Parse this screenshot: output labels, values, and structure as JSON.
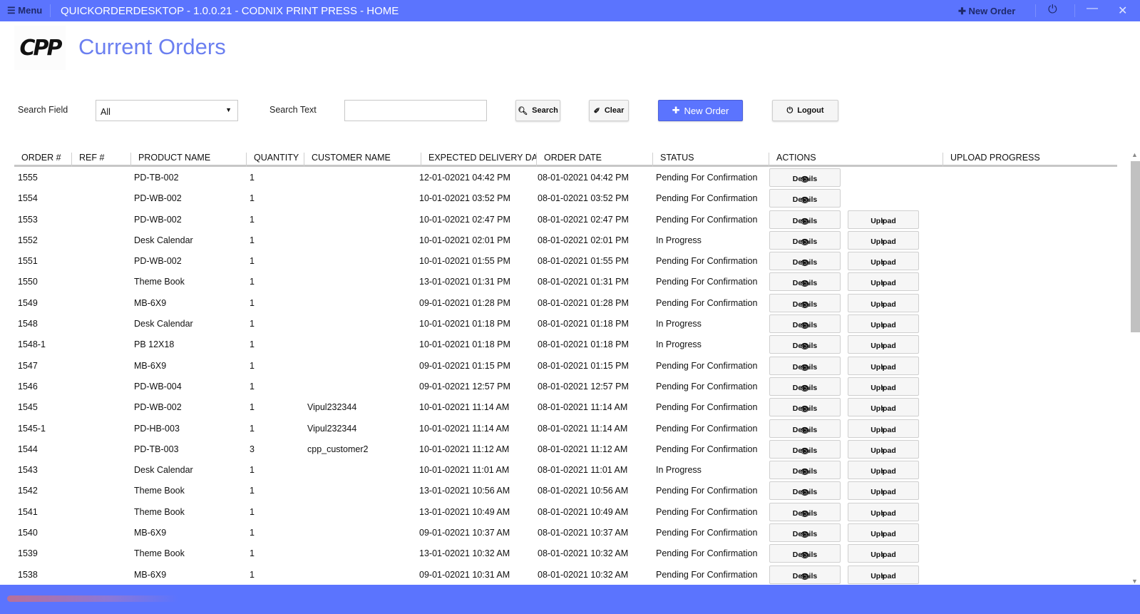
{
  "window": {
    "menu_label": "Menu",
    "title": "QUICKORDERDESKTOP - 1.0.0.21 - CODNIX PRINT PRESS - HOME",
    "new_order_label": "New Order"
  },
  "header": {
    "logo_text": "CPP",
    "page_title": "Current Orders"
  },
  "search": {
    "field_label": "Search Field",
    "field_value": "All",
    "text_label": "Search Text",
    "text_value": "",
    "search_label": "Search",
    "clear_label": "Clear",
    "new_order_label": "New Order",
    "logout_label": "Logout"
  },
  "columns": [
    "ORDER #",
    "REF #",
    "PRODUCT NAME",
    "QUANTITY",
    "CUSTOMER NAME",
    "EXPECTED DELIVERY DATE",
    "ORDER DATE",
    "STATUS",
    "ACTIONS",
    "UPLOAD PROGRESS"
  ],
  "action_labels": {
    "details": "Details",
    "upload": "Upload"
  },
  "orders": [
    {
      "order": "1555",
      "ref": "",
      "product": "PD-TB-002",
      "qty": "1",
      "customer": "",
      "expected": "12-01-02021 04:42 PM",
      "date": "08-01-02021 04:42 PM",
      "status": "Pending For Confirmation",
      "upload": false
    },
    {
      "order": "1554",
      "ref": "",
      "product": "PD-WB-002",
      "qty": "1",
      "customer": "",
      "expected": "10-01-02021 03:52 PM",
      "date": "08-01-02021 03:52 PM",
      "status": "Pending For Confirmation",
      "upload": false
    },
    {
      "order": "1553",
      "ref": "",
      "product": "PD-WB-002",
      "qty": "1",
      "customer": "",
      "expected": "10-01-02021 02:47 PM",
      "date": "08-01-02021 02:47 PM",
      "status": "Pending For Confirmation",
      "upload": true
    },
    {
      "order": "1552",
      "ref": "",
      "product": "Desk Calendar",
      "qty": "1",
      "customer": "",
      "expected": "10-01-02021 02:01 PM",
      "date": "08-01-02021 02:01 PM",
      "status": "In Progress",
      "upload": true
    },
    {
      "order": "1551",
      "ref": "",
      "product": "PD-WB-002",
      "qty": "1",
      "customer": "",
      "expected": "10-01-02021 01:55 PM",
      "date": "08-01-02021 01:55 PM",
      "status": "Pending For Confirmation",
      "upload": true
    },
    {
      "order": "1550",
      "ref": "",
      "product": "Theme Book",
      "qty": "1",
      "customer": "",
      "expected": "13-01-02021 01:31 PM",
      "date": "08-01-02021 01:31 PM",
      "status": "Pending For Confirmation",
      "upload": true
    },
    {
      "order": "1549",
      "ref": "",
      "product": "MB-6X9",
      "qty": "1",
      "customer": "",
      "expected": "09-01-02021 01:28 PM",
      "date": "08-01-02021 01:28 PM",
      "status": "Pending For Confirmation",
      "upload": true
    },
    {
      "order": "1548",
      "ref": "",
      "product": "Desk Calendar",
      "qty": "1",
      "customer": "",
      "expected": "10-01-02021 01:18 PM",
      "date": "08-01-02021 01:18 PM",
      "status": "In Progress",
      "upload": true
    },
    {
      "order": "1548-1",
      "ref": "",
      "product": "PB 12X18",
      "qty": "1",
      "customer": "",
      "expected": "10-01-02021 01:18 PM",
      "date": "08-01-02021 01:18 PM",
      "status": "In Progress",
      "upload": true
    },
    {
      "order": "1547",
      "ref": "",
      "product": "MB-6X9",
      "qty": "1",
      "customer": "",
      "expected": "09-01-02021 01:15 PM",
      "date": "08-01-02021 01:15 PM",
      "status": "Pending For Confirmation",
      "upload": true
    },
    {
      "order": "1546",
      "ref": "",
      "product": "PD-WB-004",
      "qty": "1",
      "customer": "",
      "expected": "09-01-02021 12:57 PM",
      "date": "08-01-02021 12:57 PM",
      "status": "Pending For Confirmation",
      "upload": true
    },
    {
      "order": "1545",
      "ref": "",
      "product": "PD-WB-002",
      "qty": "1",
      "customer": "Vipul232344",
      "expected": "10-01-02021 11:14 AM",
      "date": "08-01-02021 11:14 AM",
      "status": "Pending For Confirmation",
      "upload": true
    },
    {
      "order": "1545-1",
      "ref": "",
      "product": " PD-HB-003",
      "qty": "1",
      "customer": "Vipul232344",
      "expected": "10-01-02021 11:14 AM",
      "date": "08-01-02021 11:14 AM",
      "status": "Pending For Confirmation",
      "upload": true
    },
    {
      "order": "1544",
      "ref": "",
      "product": "PD-TB-003",
      "qty": "3",
      "customer": "cpp_customer2",
      "expected": "10-01-02021 11:12 AM",
      "date": "08-01-02021 11:12 AM",
      "status": "Pending For Confirmation",
      "upload": true
    },
    {
      "order": "1543",
      "ref": "",
      "product": "Desk Calendar",
      "qty": "1",
      "customer": "",
      "expected": "10-01-02021 11:01 AM",
      "date": "08-01-02021 11:01 AM",
      "status": "In Progress",
      "upload": true
    },
    {
      "order": "1542",
      "ref": "",
      "product": "Theme Book",
      "qty": "1",
      "customer": "",
      "expected": "13-01-02021 10:56 AM",
      "date": "08-01-02021 10:56 AM",
      "status": "Pending For Confirmation",
      "upload": true
    },
    {
      "order": "1541",
      "ref": "",
      "product": "Theme Book",
      "qty": "1",
      "customer": "",
      "expected": "13-01-02021 10:49 AM",
      "date": "08-01-02021 10:49 AM",
      "status": "Pending For Confirmation",
      "upload": true
    },
    {
      "order": "1540",
      "ref": "",
      "product": "MB-6X9",
      "qty": "1",
      "customer": "",
      "expected": "09-01-02021 10:37 AM",
      "date": "08-01-02021 10:37 AM",
      "status": "Pending For Confirmation",
      "upload": true
    },
    {
      "order": "1539",
      "ref": "",
      "product": "Theme Book",
      "qty": "1",
      "customer": "",
      "expected": "13-01-02021 10:32 AM",
      "date": "08-01-02021 10:32 AM",
      "status": "Pending For Confirmation",
      "upload": true
    },
    {
      "order": "1538",
      "ref": "",
      "product": "MB-6X9",
      "qty": "1",
      "customer": "",
      "expected": "09-01-02021 10:31 AM",
      "date": "08-01-02021 10:32 AM",
      "status": "Pending For Confirmation",
      "upload": true
    }
  ],
  "colors": {
    "accent": "#5b74fe",
    "title": "#6b7ff0"
  }
}
